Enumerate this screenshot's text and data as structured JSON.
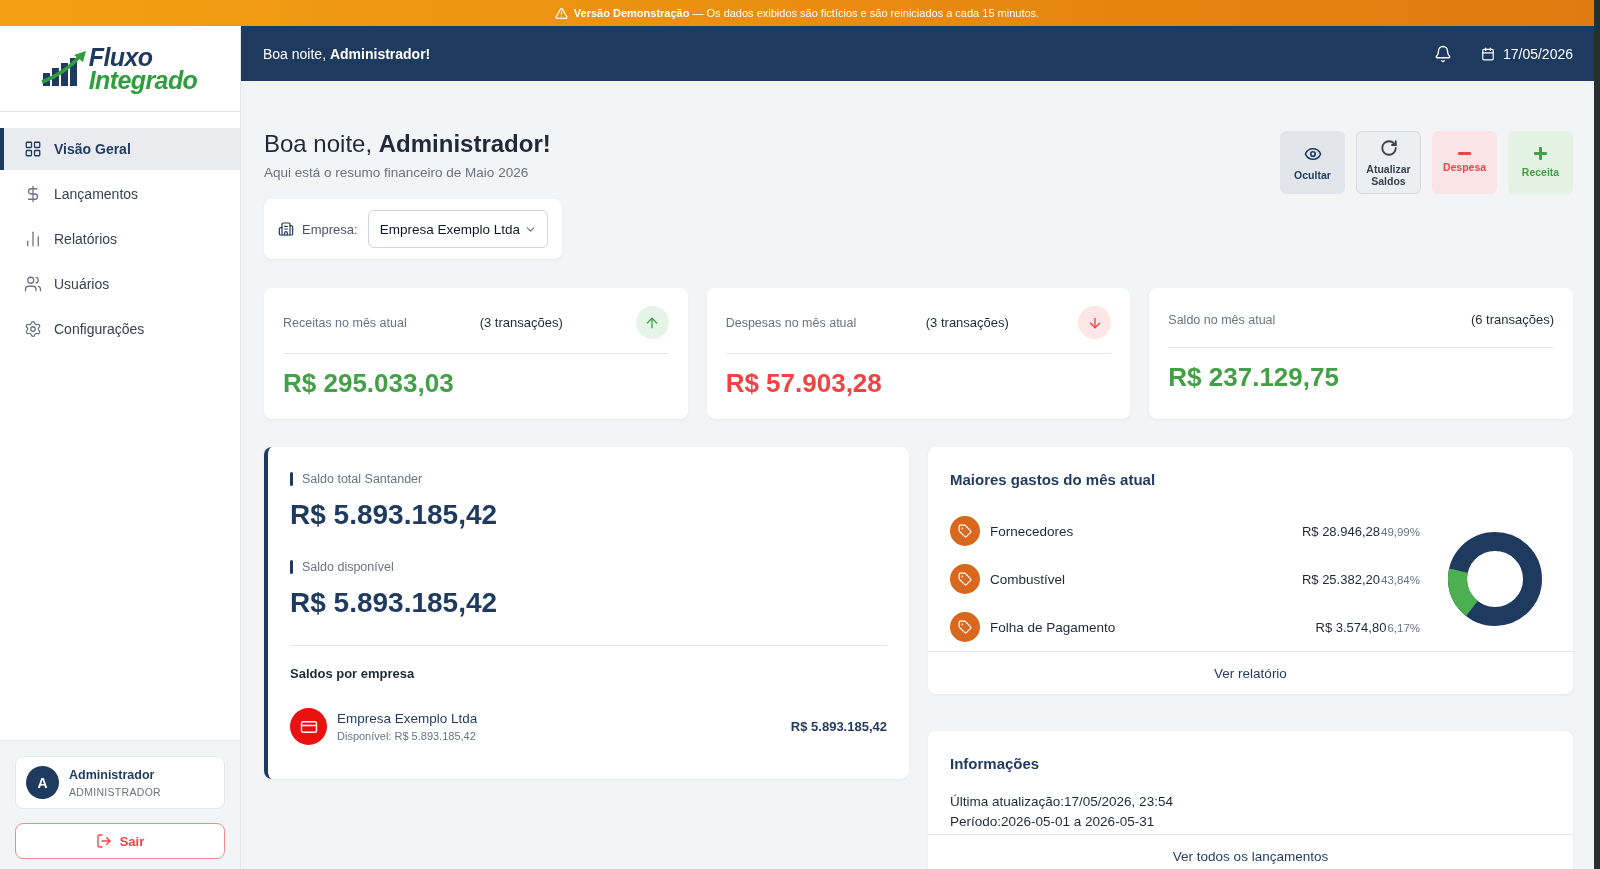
{
  "demo_banner": {
    "text": "**Versão Demonstração** — Os dados exibidos são fictícios e são reiniciados a cada 15 minutos."
  },
  "sidebar": {
    "logo": {
      "line_1": "Fluxo",
      "line_2": "Integrado"
    },
    "nav": [
      {
        "label": "Visão Geral",
        "selected": true
      },
      {
        "label": "Lançamentos",
        "selected": false
      },
      {
        "label": "Relatórios",
        "selected": false
      },
      {
        "label": "Usuários",
        "selected": false
      },
      {
        "label": "Configurações",
        "selected": false
      }
    ],
    "user": {
      "initial": "A",
      "name": "Administrador",
      "role": "ADMINISTRADOR"
    },
    "logout_button": "Sair"
  },
  "header": {
    "greeting": "Boa noite, **Administrador!**",
    "date": "17/05/2026"
  },
  "page": {
    "title": "Boa noite, **Administrador!**",
    "subtitle": "Aqui está o resumo financeiro de Maio 2026",
    "company_filter": {
      "label": "Empresa:",
      "value": "Empresa Exemplo Ltda"
    },
    "actions": [
      {
        "kind": "hide",
        "label": "Ocultar"
      },
      {
        "kind": "refresh",
        "label": "Atualizar Saldos"
      },
      {
        "kind": "expense",
        "label": "Despesa"
      },
      {
        "kind": "income",
        "label": "Receita"
      }
    ]
  },
  "summary_cards": [
    {
      "kind": "income",
      "label": "Receitas no mês atual",
      "count": "(3 transações)",
      "value": "R$ 295.033,03"
    },
    {
      "kind": "expense",
      "label": "Despesas no mês atual",
      "count": "(3 transações)",
      "value": "R$ 57.903,28"
    },
    {
      "kind": "balance",
      "label": "Saldo no mês atual",
      "count": "(6 transações)",
      "value": "R$ 237.129,75"
    }
  ],
  "balance_card": {
    "sections": [
      {
        "label": "Saldo total Santander",
        "value": "R$ 5.893.185,42"
      },
      {
        "label": "Saldo disponível",
        "value": "R$ 5.893.185,42"
      }
    ],
    "companies_title": "Saldos por empresa",
    "companies": [
      {
        "name": "Empresa Exemplo Ltda",
        "available": "Disponível: R$ 5.893.185,42",
        "amount": "R$ 5.893.185,42"
      }
    ]
  },
  "top_expenses": {
    "title": "Maiores gastos do mês atual",
    "items": [
      {
        "name": "Fornecedores",
        "amount": "R$ 28.946,28",
        "percent": "49,99%"
      },
      {
        "name": "Combustível",
        "amount": "R$ 25.382,20",
        "percent": "43,84%"
      },
      {
        "name": "Folha de Pagamento",
        "amount": "R$ 3.574,80",
        "percent": "6,17%"
      }
    ],
    "link": "Ver relatório"
  },
  "info": {
    "title": "Informações",
    "lines": [
      "Última atualização:17/05/2026, 23:54",
      "Período:2026-05-01 a 2026-05-31"
    ],
    "link": "Ver todos os lançamentos"
  }
}
